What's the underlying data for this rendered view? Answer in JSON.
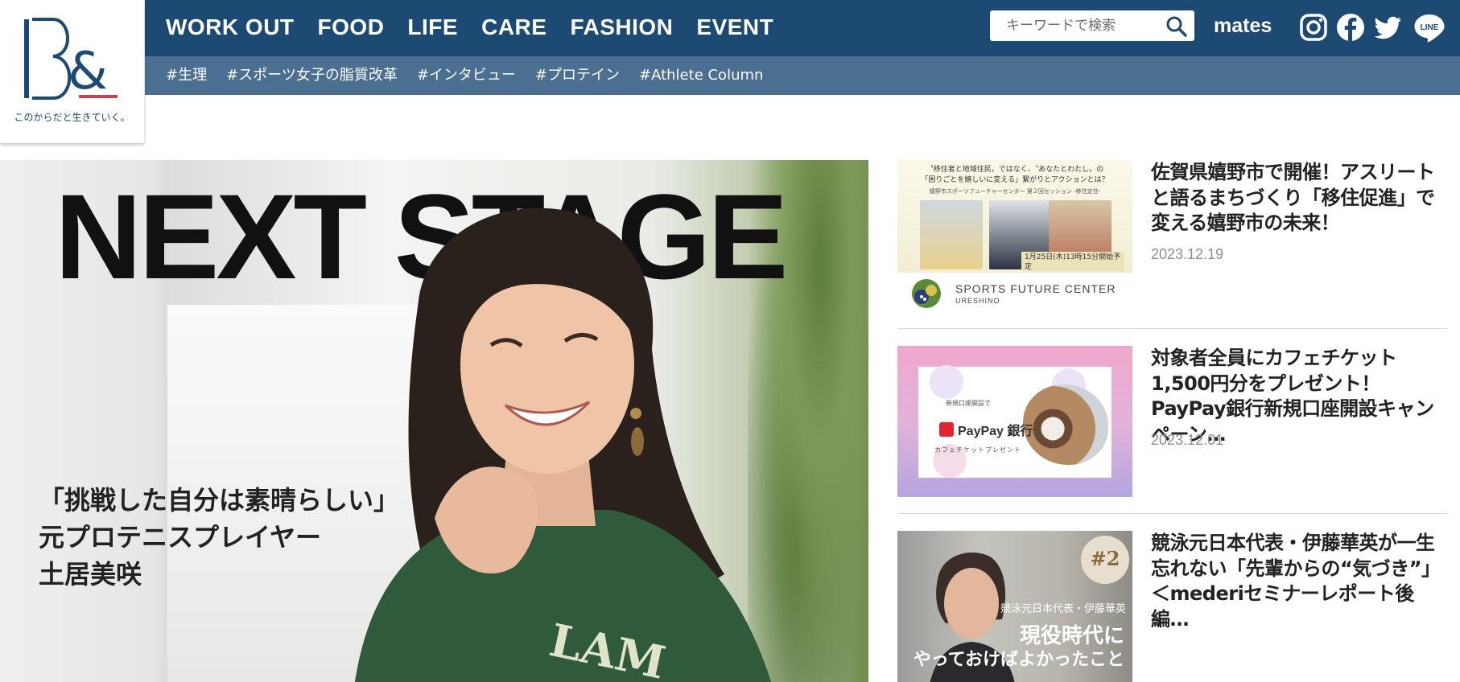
{
  "brand": {
    "tagline": "このからだと生きていく。",
    "colors": {
      "header": "#1c4a72",
      "subbar": "#4a6f91",
      "accent": "#c8414b"
    }
  },
  "nav": {
    "items": [
      "WORK OUT",
      "FOOD",
      "LIFE",
      "CARE",
      "FASHION",
      "EVENT"
    ]
  },
  "search": {
    "placeholder": "キーワードで検索",
    "icon": "search-icon"
  },
  "mates_label": "mates",
  "social": [
    "instagram-icon",
    "facebook-icon",
    "twitter-icon",
    "line-icon"
  ],
  "line_label": "LINE",
  "tags": [
    "#生理",
    "#スポーツ女子の脂質改革",
    "#インタビュー",
    "#プロテイン",
    "#Athlete Column"
  ],
  "hero": {
    "title": "NEXT STAGE",
    "caption": [
      "「挑戦した自分は素晴らしい」",
      "元プロテニスプレイヤー",
      "土居美咲"
    ]
  },
  "articles": [
    {
      "title": "佐賀県嬉野市で開催！アスリートと語るまちづくり「移住促進」で変える嬉野市の未来！",
      "date": "2023.12.19",
      "thumb": {
        "headline": "〝移住者と地域住民〟ではなく、〝あなたとわたし〟の\n「困りごとを嬉しいに変える」繋がりとアクションとは？",
        "subline": "嬉野市スポーツフューチャーセンター 第２回セッション -移住定住-",
        "event_date": "1月25日(木)13時15分開始予定",
        "brand": "SPORTS FUTURE CENTER",
        "brand_sub": "URESHINO"
      }
    },
    {
      "title": "対象者全員にカフェチケット1,500円分をプレゼント！PayPay銀行新規口座開設キャンペーン…",
      "date": "2023.12.01",
      "thumb": {
        "top_text": "新規口座開設で",
        "logo_text": "PayPay 銀行",
        "bottom_text": "カフェチケットプレゼント"
      }
    },
    {
      "title": "競泳元日本代表・伊藤華英が一生忘れない「先輩からの“気づき”」＜mederiセミナーレポート後編…",
      "date": "",
      "thumb": {
        "badge": "#2",
        "line1": "競泳元日本代表・伊藤華英",
        "line2": "現役時代に",
        "line3": "やっておけばよかったこと"
      }
    }
  ]
}
